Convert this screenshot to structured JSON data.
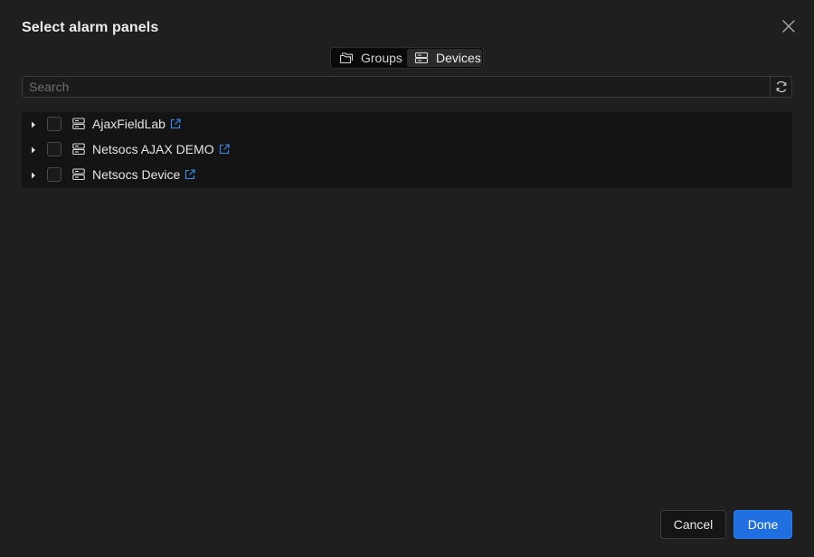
{
  "dialog": {
    "title": "Select alarm panels"
  },
  "view_toggle": {
    "options": [
      {
        "label": "Groups",
        "icon": "folders-icon",
        "active": false
      },
      {
        "label": "Devices",
        "icon": "server-icon",
        "active": true
      }
    ]
  },
  "search": {
    "placeholder": "Search",
    "value": ""
  },
  "tree": {
    "items": [
      {
        "label": "AjaxFieldLab",
        "checked": false,
        "expanded": false
      },
      {
        "label": "Netsocs AJAX DEMO",
        "checked": false,
        "expanded": false
      },
      {
        "label": "Netsocs Device",
        "checked": false,
        "expanded": false
      }
    ]
  },
  "footer": {
    "cancel_label": "Cancel",
    "done_label": "Done"
  },
  "colors": {
    "background": "#1f1f1f",
    "list_background": "#141414",
    "primary": "#1f6fe0",
    "link": "#3b8cf0"
  }
}
